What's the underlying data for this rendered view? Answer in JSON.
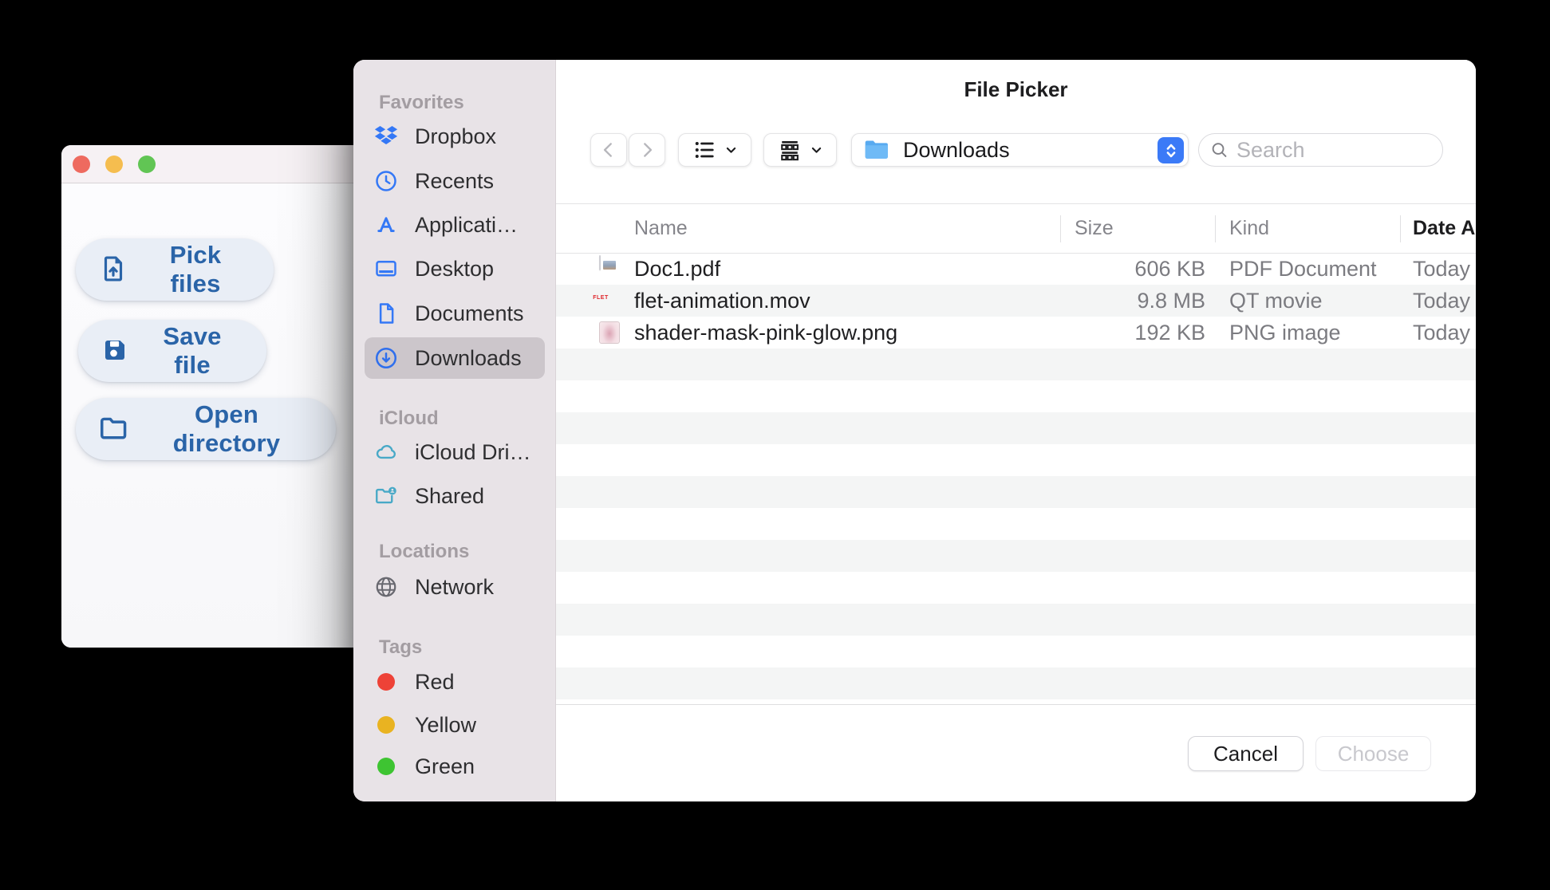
{
  "app_window": {
    "buttons": {
      "pick": {
        "label": "Pick files"
      },
      "save": {
        "label": "Save file"
      },
      "open": {
        "label": "Open directory"
      }
    }
  },
  "file_picker": {
    "title": "File Picker",
    "toolbar": {
      "location": "Downloads",
      "search_placeholder": "Search"
    },
    "sidebar": {
      "sections": [
        {
          "title": "Favorites",
          "items": [
            {
              "label": "Dropbox"
            },
            {
              "label": "Recents"
            },
            {
              "label": "Applicati…"
            },
            {
              "label": "Desktop"
            },
            {
              "label": "Documents"
            },
            {
              "label": "Downloads",
              "selected": true
            }
          ]
        },
        {
          "title": "iCloud",
          "items": [
            {
              "label": "iCloud Dri…"
            },
            {
              "label": "Shared"
            }
          ]
        },
        {
          "title": "Locations",
          "items": [
            {
              "label": "Network"
            }
          ]
        },
        {
          "title": "Tags",
          "items": [
            {
              "label": "Red",
              "color": "#ee4237"
            },
            {
              "label": "Yellow",
              "color": "#e9b321"
            },
            {
              "label": "Green",
              "color": "#3ec432"
            }
          ]
        }
      ]
    },
    "table": {
      "columns": {
        "name": "Name",
        "size": "Size",
        "kind": "Kind",
        "date": "Date Added"
      },
      "sort_column": "Date Added",
      "rows": [
        {
          "name": "Doc1.pdf",
          "size": "606 KB",
          "kind": "PDF Document",
          "date": "Today"
        },
        {
          "name": "flet-animation.mov",
          "size": "9.8 MB",
          "kind": "QT movie",
          "date": "Today"
        },
        {
          "name": "shader-mask-pink-glow.png",
          "size": "192 KB",
          "kind": "PNG image",
          "date": "Today"
        }
      ],
      "movie_icon_text": "FLET"
    },
    "footer": {
      "cancel": "Cancel",
      "choose": "Choose"
    }
  },
  "colors": {
    "sidebar_icon_blue": "#3478f6",
    "icloud_teal": "#48a9c7",
    "app_accent_blue": "#2a64a8",
    "traffic_red": "#ee6a5f",
    "traffic_yellow": "#f5bd4f",
    "traffic_green": "#61c554",
    "stripe_gray": "#f4f5f5",
    "sidebar_bg": "#e8e3e7"
  }
}
